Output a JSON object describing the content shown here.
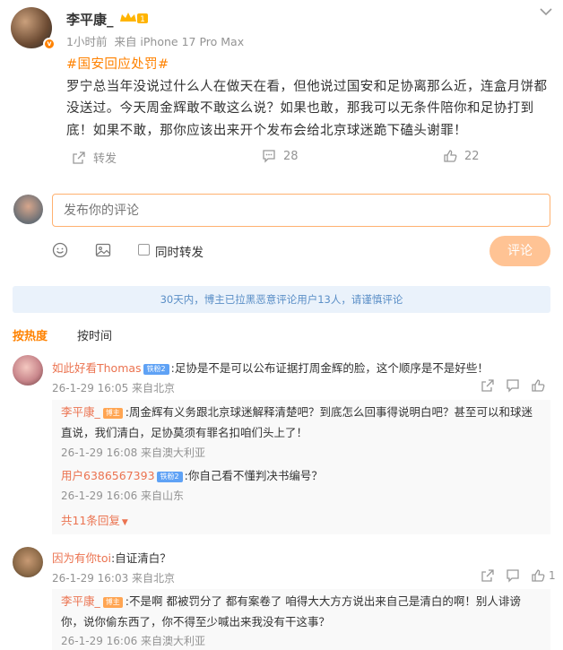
{
  "post": {
    "author": "李平康_",
    "badge_text": "1",
    "time": "1小时前",
    "source": "来自 iPhone 17 Pro Max",
    "hashtag": "#国安回应处罚#",
    "text": "罗宁总当年没说过什么人在做天在看，但他说过国安和足协离那么近，连盒月饼都没送过。今天周金辉敢不敢这么说？如果也敢，那我可以无条件陪你和足协打到底！如果不敢，那你应该出来开个发布会给北京球迷跪下磕头谢罪！",
    "repost_label": "转发",
    "comment_count": "28",
    "like_count": "22"
  },
  "composer": {
    "placeholder": "发布你的评论",
    "repost_also": "同时转发",
    "submit": "评论"
  },
  "notice": "30天内，博主已拉黑恶意评论用户13人，请谨慎评论",
  "sort": {
    "hot": "按热度",
    "time": "按时间"
  },
  "comments": [
    {
      "user": "如此好看Thomas",
      "fan_badge": "铁粉2",
      "text": ":足协是不是可以公布证据打周金辉的脸，这个顺序是不是好些！",
      "meta": "26-1-29 16:05 来自北京",
      "replies": [
        {
          "user": "李平康_",
          "tag": "博主",
          "text": ":周金辉有义务跟北京球迷解释清楚吧？到底怎么回事得说明白吧？甚至可以和球迷直说，我们清白，足协莫须有罪名扣咱们头上了！",
          "meta": "26-1-29 16:08 来自澳大利亚"
        },
        {
          "user": "用户6386567393",
          "fan_badge": "铁粉2",
          "text": ":你自己看不懂判决书编号？",
          "meta": "26-1-29 16:06 来自山东"
        }
      ],
      "more_replies": "共11条回复"
    },
    {
      "user": "因为有你toi",
      "text": ":自证清白？",
      "meta": "26-1-29 16:03 来自北京",
      "like_count": "1",
      "replies": [
        {
          "user": "李平康_",
          "tag": "博主",
          "text": ":不是啊 都被罚分了 都有案卷了 咱得大大方方说出来自己是清白的啊！别人诽谤你，说你偷东西了，你不得至少喊出来我没有干这事？",
          "meta": "26-1-29 16:06 来自澳大利亚"
        }
      ]
    }
  ],
  "colors": {
    "accent": "#ff8200",
    "name_link": "#eb7350",
    "notice_text": "#5b8fc7",
    "notice_bg": "#eaf2fb"
  },
  "icons": [
    "chevron-down-icon",
    "repost-icon",
    "comment-icon",
    "like-icon",
    "emoji-icon",
    "image-icon",
    "share-icon",
    "comment-bubble-icon"
  ]
}
